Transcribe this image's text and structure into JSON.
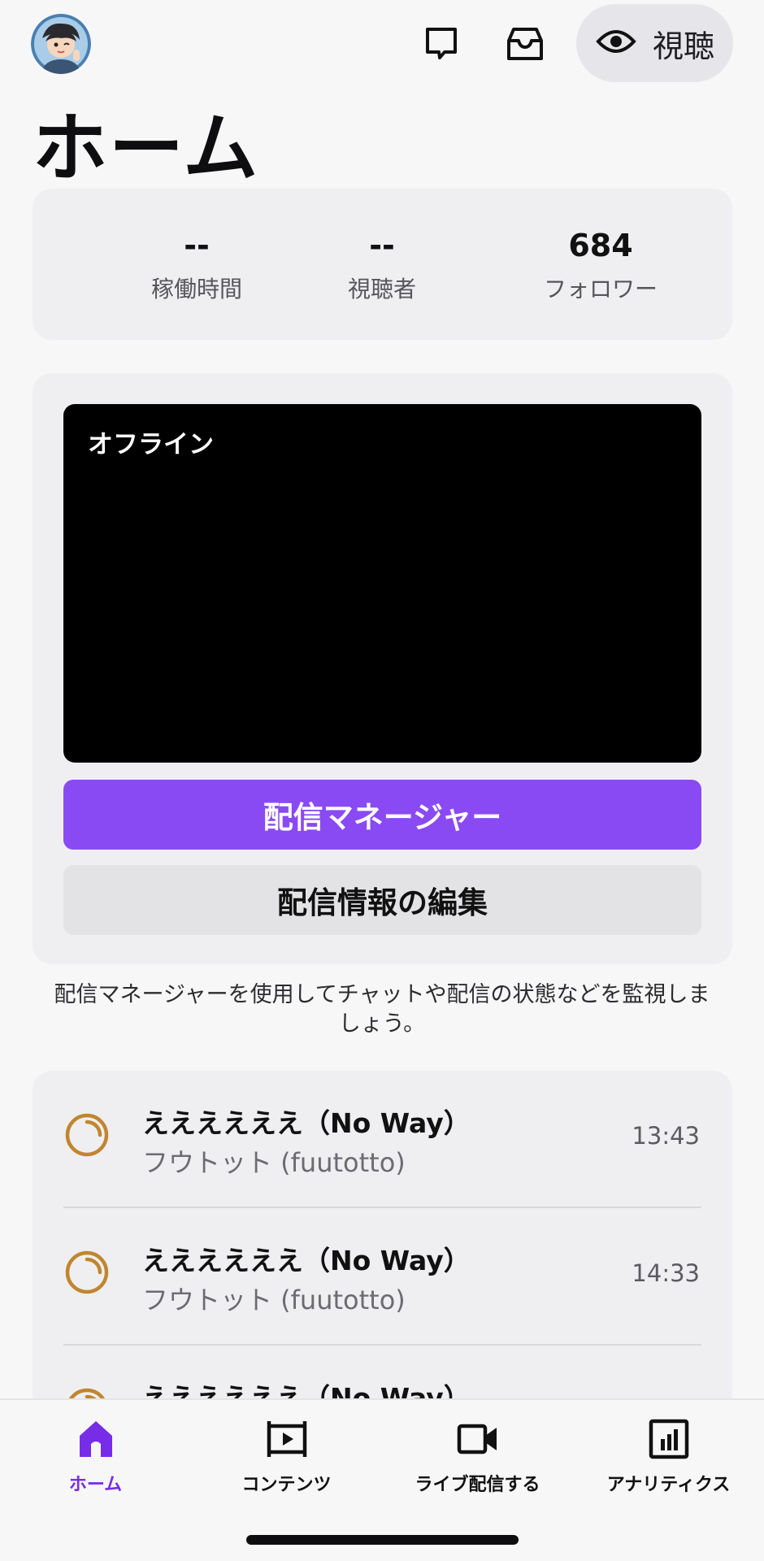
{
  "header": {
    "watch_label": "視聴",
    "icons": [
      "avatar",
      "chat-bubble-icon",
      "inbox-icon",
      "eye-icon"
    ]
  },
  "page_title": "ホーム",
  "stats": [
    {
      "value": "--",
      "label": "稼働時間"
    },
    {
      "value": "--",
      "label": "視聴者"
    },
    {
      "value": "684",
      "label": "フォロワー"
    }
  ],
  "stream": {
    "status": "オフライン",
    "primary_button": "配信マネージャー",
    "secondary_button": "配信情報の編集",
    "helper_text": "配信マネージャーを使用してチャットや配信の状態などを監視しましょう。"
  },
  "activity": [
    {
      "title": "ええええええ（No Way）",
      "subtitle": "フウトット (fuutotto)",
      "time": "13:43",
      "icon": "timer-icon"
    },
    {
      "title": "ええええええ（No Way）",
      "subtitle": "フウトット (fuutotto)",
      "time": "14:33",
      "icon": "timer-icon"
    },
    {
      "title": "ええええええ（No Way）",
      "subtitle": "",
      "time": "",
      "icon": "timer-icon"
    }
  ],
  "nav": [
    {
      "label": "ホーム",
      "icon": "home-icon",
      "active": true
    },
    {
      "label": "コンテンツ",
      "icon": "film-icon",
      "active": false
    },
    {
      "label": "ライブ配信する",
      "icon": "video-camera-icon",
      "active": false
    },
    {
      "label": "アナリティクス",
      "icon": "analytics-icon",
      "active": false
    }
  ],
  "colors": {
    "accent": "#8a4af3",
    "accent_text": "#772ce8",
    "card_bg": "#efeff1",
    "timer_icon": "#c0862f"
  }
}
